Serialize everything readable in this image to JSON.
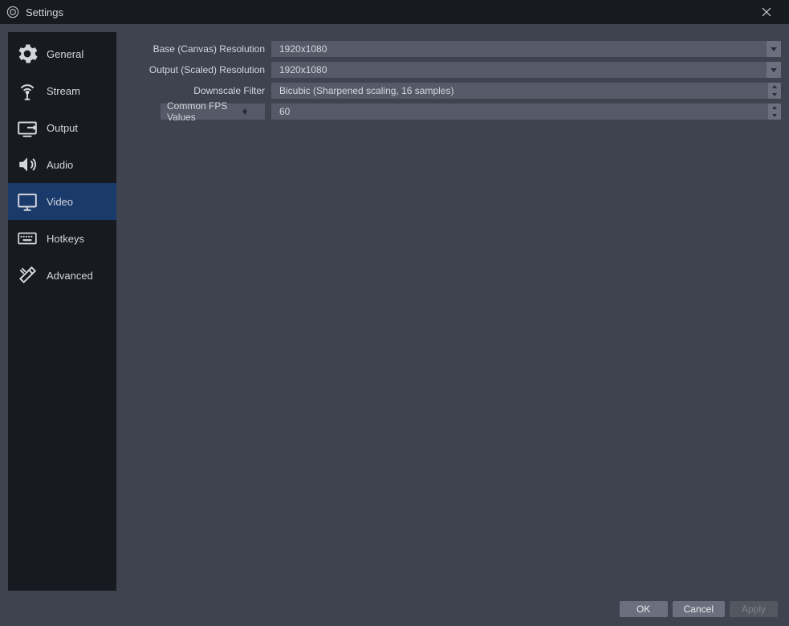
{
  "window": {
    "title": "Settings"
  },
  "sidebar": {
    "items": [
      {
        "id": "general",
        "label": "General"
      },
      {
        "id": "stream",
        "label": "Stream"
      },
      {
        "id": "output",
        "label": "Output"
      },
      {
        "id": "audio",
        "label": "Audio"
      },
      {
        "id": "video",
        "label": "Video"
      },
      {
        "id": "hotkeys",
        "label": "Hotkeys"
      },
      {
        "id": "advanced",
        "label": "Advanced"
      }
    ],
    "selected": "video"
  },
  "video": {
    "base_resolution": {
      "label": "Base (Canvas) Resolution",
      "value": "1920x1080"
    },
    "output_resolution": {
      "label": "Output (Scaled) Resolution",
      "value": "1920x1080"
    },
    "downscale_filter": {
      "label": "Downscale Filter",
      "value": "Bicubic (Sharpened scaling, 16 samples)"
    },
    "fps_mode": {
      "label": "Common FPS Values"
    },
    "fps_value": {
      "value": "60"
    }
  },
  "footer": {
    "ok": "OK",
    "cancel": "Cancel",
    "apply": "Apply"
  },
  "colors": {
    "titlebar": "#181a21",
    "panel": "#3f4350",
    "sidebar": "#181a21",
    "selected": "#1a3a6c",
    "field": "#555a68",
    "button": "#6b707e"
  }
}
